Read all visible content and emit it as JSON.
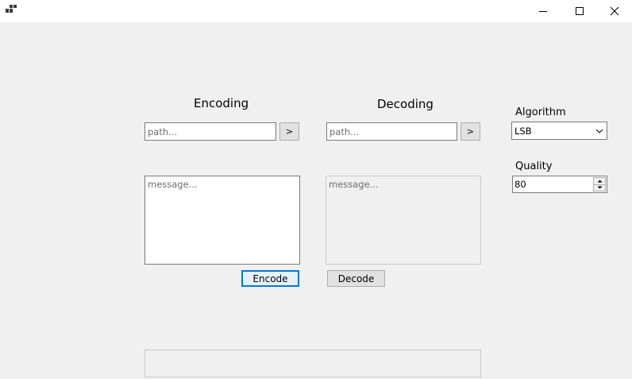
{
  "window": {
    "icons": {
      "app": "app-icon",
      "minimize": "minimize-icon",
      "maximize": "maximize-icon",
      "close": "close-icon"
    }
  },
  "encoding": {
    "heading": "Encoding",
    "path_placeholder": "path...",
    "path_value": "",
    "browse_label": ">",
    "message_placeholder": "message...",
    "message_value": "",
    "encode_label": "Encode"
  },
  "decoding": {
    "heading": "Decoding",
    "path_placeholder": "path...",
    "path_value": "",
    "browse_label": ">",
    "message_placeholder": "message...",
    "message_value": "",
    "decode_label": "Decode"
  },
  "settings": {
    "algorithm_label": "Algorithm",
    "algorithm_value": "LSB",
    "quality_label": "Quality",
    "quality_value": "80"
  },
  "status": {
    "text": ""
  },
  "colors": {
    "background": "#f0f0f0",
    "focus_accent": "#0078d7",
    "close_hover": "#e81123"
  }
}
